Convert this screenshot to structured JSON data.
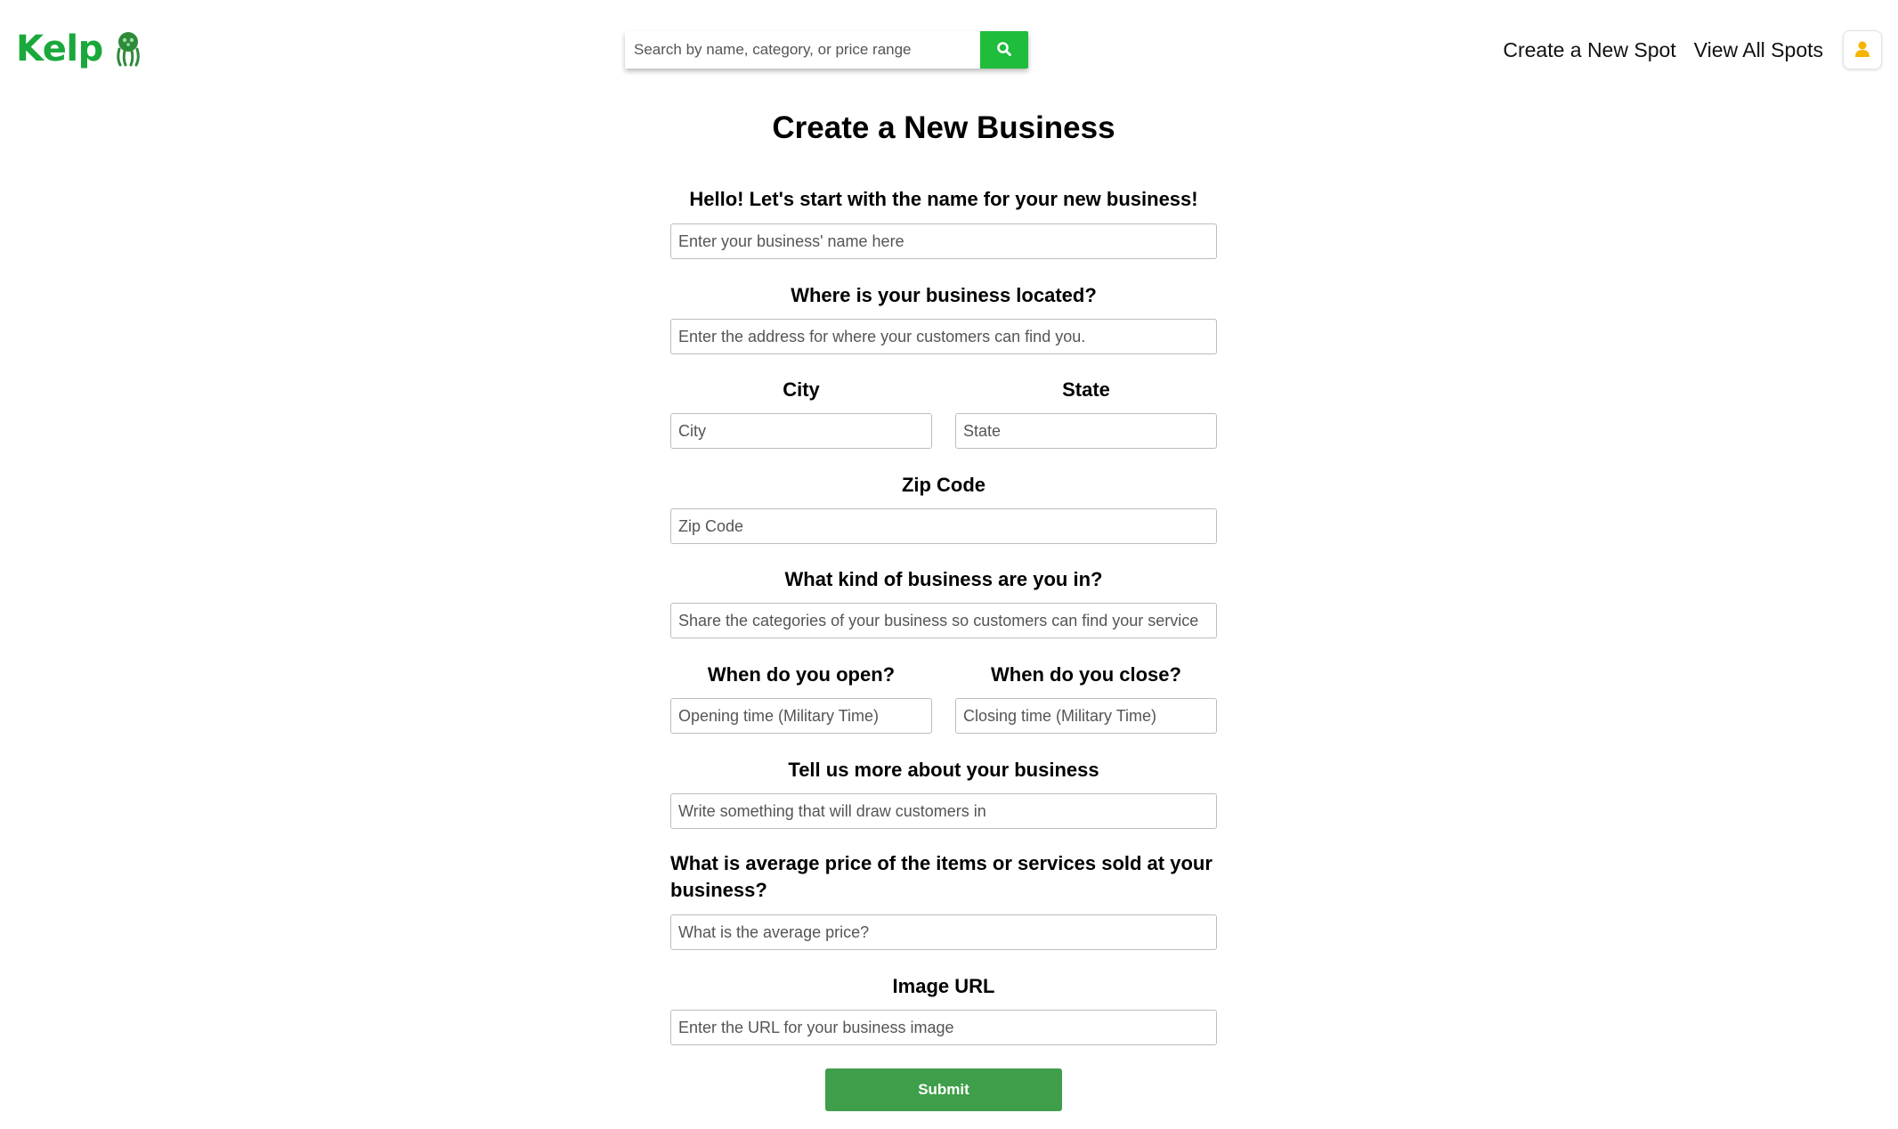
{
  "header": {
    "logo_text": "Kelp",
    "search_placeholder": "Search by name, category, or price range",
    "nav": {
      "create_spot": "Create a New Spot",
      "view_spots": "View All Spots"
    }
  },
  "form": {
    "title": "Create a New Business",
    "name": {
      "label": "Hello! Let's start with the name for your new business!",
      "placeholder": "Enter your business' name here"
    },
    "address": {
      "label": "Where is your business located?",
      "placeholder": "Enter the address for where your customers can find you."
    },
    "city": {
      "label": "City",
      "placeholder": "City"
    },
    "state": {
      "label": "State",
      "placeholder": "State"
    },
    "zip": {
      "label": "Zip Code",
      "placeholder": "Zip Code"
    },
    "category": {
      "label": "What kind of business are you in?",
      "placeholder": "Share the categories of your business so customers can find your service"
    },
    "open": {
      "label": "When do you open?",
      "placeholder": "Opening time (Military Time)"
    },
    "close": {
      "label": "When do you close?",
      "placeholder": "Closing time (Military Time)"
    },
    "description": {
      "label": "Tell us more about your business",
      "placeholder": "Write something that will draw customers in"
    },
    "price": {
      "label": "What is average price of the items or services sold at your business?",
      "placeholder": "What is the average price?"
    },
    "image": {
      "label": "Image URL",
      "placeholder": "Enter the URL for your business image"
    },
    "submit_label": "Submit"
  },
  "colors": {
    "brand_green": "#1aa83c",
    "search_button": "#1ebd3c",
    "submit_button": "#3f9e4a",
    "profile_icon": "#f5b400"
  },
  "icons": [
    "kelp-logo-icon",
    "search-icon",
    "user-icon"
  ]
}
